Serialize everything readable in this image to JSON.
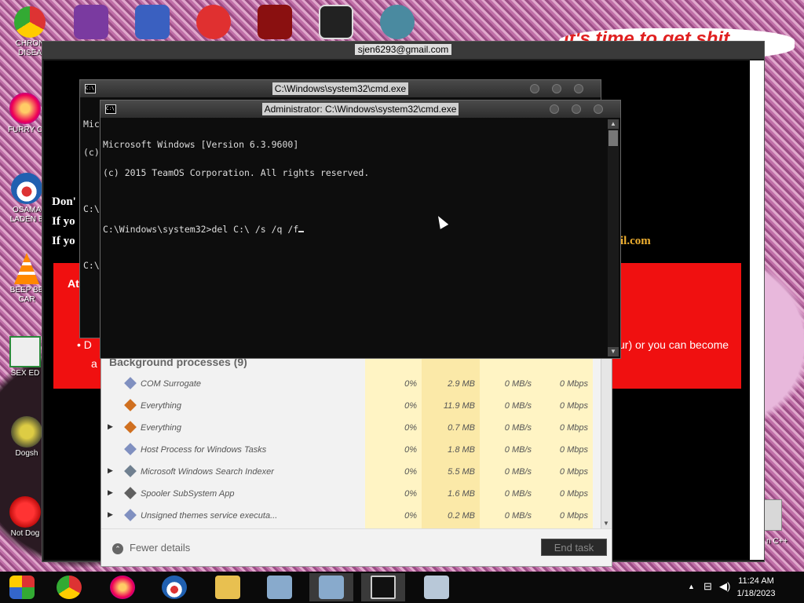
{
  "desktop": {
    "icons": [
      {
        "label": "CHRON\nDISEA",
        "color": "#2a8a3a"
      },
      {
        "label": "FURRY C",
        "color": "#e06020"
      },
      {
        "label": "OSAMA\nLADEN E",
        "color": "#2060b0"
      },
      {
        "label": "BEEP BE\nCAR",
        "color": "#f08020"
      },
      {
        "label": "SEX ED",
        "color": "#2a2a2a"
      },
      {
        "label": "Dogsh",
        "color": "#8a7a20"
      },
      {
        "label": "Not Dog",
        "color": "#c01010"
      }
    ],
    "right_icon_label": "n C++",
    "banner_text": "it's time to get shit"
  },
  "outer_window": {
    "title": "sjen6293@gmail.com",
    "lines": [
      "Don'",
      "If yo",
      "If yo"
    ],
    "email_fragment": "il.com",
    "red_box_heading": "At",
    "red_box_bullet": "• D",
    "red_box_tail": "ur) or you can become",
    "red_box_tail2": "a"
  },
  "cmd_back": {
    "title": "C:\\Windows\\system32\\cmd.exe",
    "lines": [
      "Mic",
      "(c)",
      "",
      "C:\\",
      "",
      "C:\\"
    ]
  },
  "cmd_front": {
    "title": "Administrator: C:\\Windows\\system32\\cmd.exe",
    "line1": "Microsoft Windows [Version 6.3.9600]",
    "line2": "(c) 2015 TeamOS Corporation. All rights reserved.",
    "prompt": "C:\\Windows\\system32>del C:\\ /s /q /f"
  },
  "taskmgr": {
    "section_heading": "Background processes (9)",
    "rows": [
      {
        "name": "COM Surrogate",
        "cpu": "0%",
        "mem": "2.9 MB",
        "disk": "0 MB/s",
        "net": "0 Mbps",
        "expand": false
      },
      {
        "name": "Everything",
        "cpu": "0%",
        "mem": "11.9 MB",
        "disk": "0 MB/s",
        "net": "0 Mbps",
        "expand": false
      },
      {
        "name": "Everything",
        "cpu": "0%",
        "mem": "0.7 MB",
        "disk": "0 MB/s",
        "net": "0 Mbps",
        "expand": true
      },
      {
        "name": "Host Process for Windows Tasks",
        "cpu": "0%",
        "mem": "1.8 MB",
        "disk": "0 MB/s",
        "net": "0 Mbps",
        "expand": false
      },
      {
        "name": "Microsoft Windows Search Indexer",
        "cpu": "0%",
        "mem": "5.5 MB",
        "disk": "0 MB/s",
        "net": "0 Mbps",
        "expand": true
      },
      {
        "name": "Spooler SubSystem App",
        "cpu": "0%",
        "mem": "1.6 MB",
        "disk": "0 MB/s",
        "net": "0 Mbps",
        "expand": true
      },
      {
        "name": "Unsigned themes service executa...",
        "cpu": "0%",
        "mem": "0.2 MB",
        "disk": "0 MB/s",
        "net": "0 Mbps",
        "expand": true
      }
    ],
    "fewer_details": "Fewer details",
    "end_task": "End task"
  },
  "taskbar": {
    "time": "11:24 AM",
    "date": "1/18/2023",
    "apps": [
      "start",
      "chrome",
      "firefox",
      "obama",
      "explorer",
      "installer",
      "installer",
      "cmd",
      "taskmgr"
    ]
  },
  "colors": {
    "red_box": "#f01010",
    "email": "#f0b030",
    "taskmgr_highlight": "#fff4c4"
  }
}
